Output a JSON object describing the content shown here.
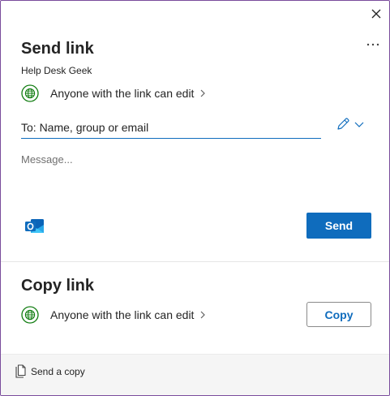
{
  "dialog": {
    "close_icon": "close-icon",
    "more_icon": "more-options-icon"
  },
  "send_link": {
    "title": "Send link",
    "owner": "Help Desk Geek",
    "permission": "Anyone with the link can edit",
    "to_placeholder": "To: Name, group or email",
    "message_placeholder": "Message...",
    "send_label": "Send",
    "outlook_icon": "outlook-icon",
    "pencil_icon": "pencil-icon"
  },
  "copy_link": {
    "title": "Copy link",
    "permission": "Anyone with the link can edit",
    "copy_label": "Copy"
  },
  "footer": {
    "send_copy_label": "Send a copy"
  },
  "colors": {
    "accent": "#0f6cbd",
    "globe_green": "#107c10",
    "border_purple": "#7a4c9c"
  }
}
